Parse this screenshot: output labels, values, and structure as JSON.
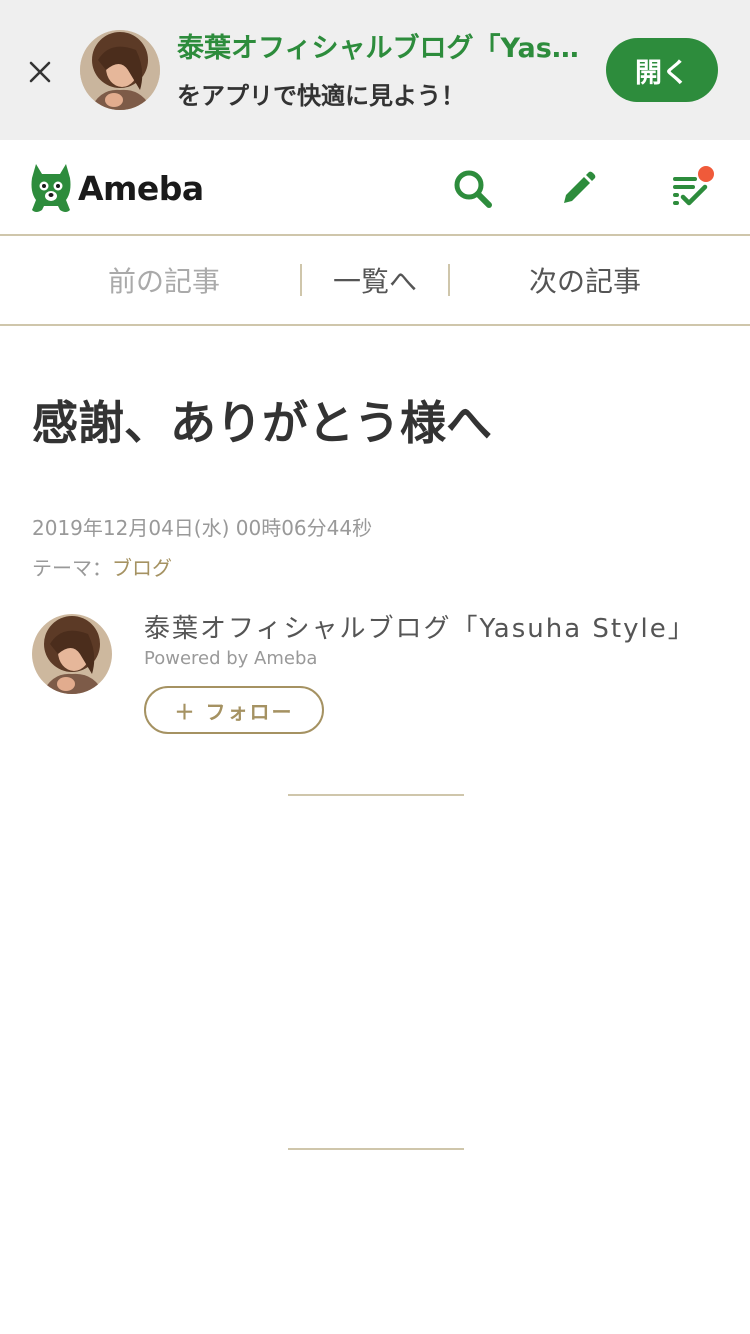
{
  "app_banner": {
    "close_label": "×",
    "title": "泰葉オフィシャルブログ「Yas…",
    "subtitle": "をアプリで快適に見よう！",
    "open_label": "開く"
  },
  "header": {
    "logo_text": "Ameba",
    "icons": [
      "search-icon",
      "pencil-icon",
      "reader-list-icon"
    ],
    "accent_color": "#2d8c3c",
    "notification_color": "#f05a3a"
  },
  "article_nav": {
    "prev_label": "前の記事",
    "list_label": "一覧へ",
    "next_label": "次の記事"
  },
  "article": {
    "title": "感謝、ありがとう様へ",
    "date": "2019年12月04日(水) 00時06分44秒",
    "theme_prefix": "テーマ：",
    "theme_link": "ブログ"
  },
  "author": {
    "name": "泰葉オフィシャルブログ「Yasuha Style」",
    "powered_by": "Powered by Ameba",
    "follow_label": "＋ フォロー"
  },
  "theme_colors": {
    "gold": "#a59262",
    "border": "#cfc6ab"
  }
}
